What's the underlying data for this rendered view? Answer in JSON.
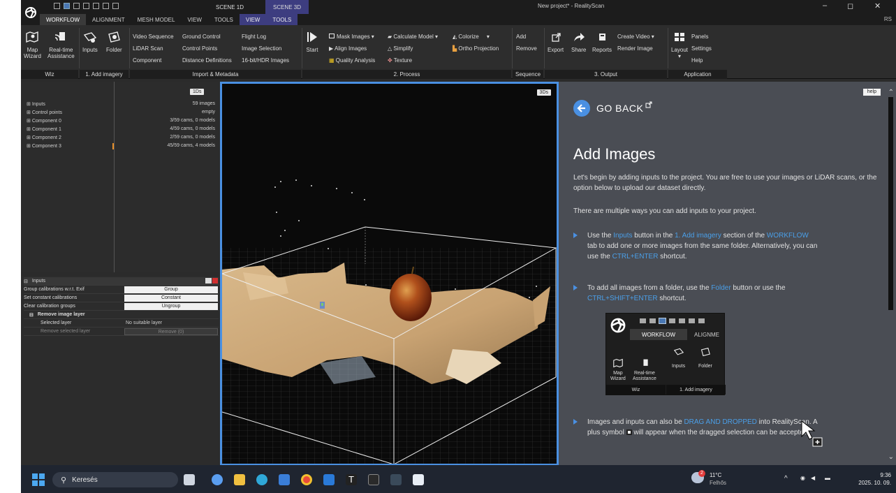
{
  "window": {
    "title": "New project* - RealityScan",
    "scene_tabs": [
      "SCENE 1D",
      "SCENE 3D"
    ],
    "controls": [
      "–",
      "◻",
      "✕"
    ],
    "user_initials": "RS"
  },
  "menu": {
    "tabs": [
      "WORKFLOW",
      "ALIGNMENT",
      "MESH MODEL",
      "VIEW",
      "TOOLS",
      "VIEW",
      "TOOLS"
    ]
  },
  "ribbon": {
    "wiz": {
      "footer": "Wiz",
      "map_wizard": "Map\nWizard",
      "realtime": "Real-time\nAssistance"
    },
    "add_imagery": {
      "footer": "1. Add imagery",
      "inputs": "Inputs",
      "folder": "Folder"
    },
    "import": {
      "footer": "Import & Metadata",
      "col1": [
        "Video Sequence",
        "LiDAR Scan",
        "Component"
      ],
      "col2": [
        "Ground Control",
        "Control Points",
        "Distance Definitions"
      ],
      "col3": [
        "Flight Log",
        "Image Selection",
        "16-bit/HDR Images"
      ]
    },
    "process": {
      "footer": "2. Process",
      "start": "Start",
      "col1": [
        "Mask Images",
        "Align Images",
        "Quality Analysis"
      ],
      "col2": [
        "Calculate Model",
        "Simplify",
        "Texture"
      ],
      "col3": [
        "Colorize",
        "Ortho Projection"
      ]
    },
    "sequence": {
      "footer": "Sequence",
      "add": "Add",
      "remove": "Remove"
    },
    "output": {
      "footer": "3. Output",
      "export": "Export",
      "share": "Share",
      "reports": "Reports",
      "create_video": "Create Video",
      "render_image": "Render Image"
    },
    "application": {
      "footer": "Application",
      "layout": "Layout",
      "panels": "Panels",
      "settings": "Settings",
      "help": "Help"
    }
  },
  "left_panel": {
    "badge": "1Ds",
    "tree": [
      {
        "name": "Inputs",
        "value": "59 images"
      },
      {
        "name": "Control points",
        "value": "empty"
      },
      {
        "name": "Component 0",
        "value": "3/59 cams, 0 models"
      },
      {
        "name": "Component 1",
        "value": "4/59 cams, 0 models"
      },
      {
        "name": "Component 2",
        "value": "2/59 cams, 0 models"
      },
      {
        "name": "Component 3",
        "value": "45/59 cams, 4 models"
      }
    ]
  },
  "inputs_panel": {
    "title": "Inputs",
    "rows": [
      {
        "label": "Group calibrations w.r.t. Exif",
        "button": "Group"
      },
      {
        "label": "Set constant calibrations",
        "button": "Constant"
      },
      {
        "label": "Clear calibration groups",
        "button": "Ungroup"
      }
    ],
    "section": "Remove image layer",
    "selected_layer_label": "Selected layer",
    "selected_layer_value": "No suitable layer",
    "remove_selected_label": "Remove selected layer",
    "remove_button": "Remove (0)"
  },
  "viewport": {
    "badge": "3Ds"
  },
  "help": {
    "help_button": "help",
    "go_back": "GO BACK",
    "heading": "Add Images",
    "intro": "Let's begin by adding inputs to the project. You are free to use your images or LiDAR scans, or the option below to upload our dataset directly.",
    "ways": "There are multiple ways you can add inputs to your project.",
    "b1": {
      "t1": "Use the ",
      "h1": "Inputs",
      "t2": " button in the ",
      "h2": "1. Add imagery",
      "t3": " section of the ",
      "h3": "WORKFLOW",
      "t4": " tab to add one or more images from the same folder. Alternatively, you can use the ",
      "h4": "CTRL+ENTER",
      "t5": " shortcut."
    },
    "b2": {
      "t1": "To add all images from a folder, use the ",
      "h1": "Folder",
      "t2": " button or use the ",
      "h2": "CTRL+SHIFT+ENTER",
      "t3": " shortcut."
    },
    "b3": {
      "t1": "Images and inputs can also be ",
      "h1": "DRAG AND DROPPED",
      "t2": " into RealityScan. A plus symbol ",
      "t3": " will appear when the dragged selection can be accepted."
    },
    "mini": {
      "tab1": "WORKFLOW",
      "tab2": "ALIGNME",
      "map": "Map\nWizard",
      "rt": "Real-time\nAssistance",
      "inputs": "Inputs",
      "folder": "Folder",
      "foot1": "Wiz",
      "foot2": "1. Add imagery"
    }
  },
  "taskbar": {
    "search": "Keresés",
    "weather_temp": "11°C",
    "weather_desc": "Felhős",
    "weather_badge": "2",
    "time": "9:36",
    "date": "2025. 10. 09."
  },
  "colors": {
    "accent": "#4a90e2",
    "panel": "#2c2c2c",
    "help_bg": "#4a4d54",
    "highlight": "#4a9fe8"
  }
}
